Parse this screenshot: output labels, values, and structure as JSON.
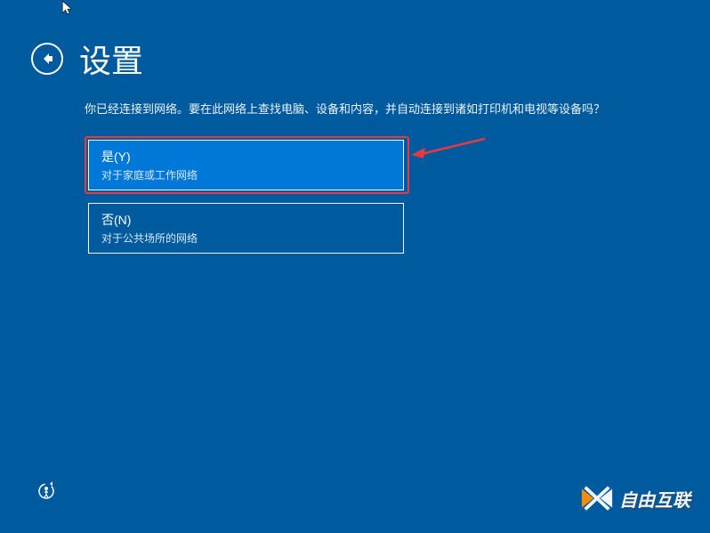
{
  "header": {
    "title": "设置"
  },
  "description": "你已经连接到网络。要在此网络上查找电脑、设备和内容，并自动连接到诸如打印机和电视等设备吗？",
  "options": {
    "yes": {
      "label": "是(Y)",
      "sub": "对于家庭或工作网络"
    },
    "no": {
      "label": "否(N)",
      "sub": "对于公共场所的网络"
    }
  },
  "watermark": {
    "text": "自由互联"
  }
}
